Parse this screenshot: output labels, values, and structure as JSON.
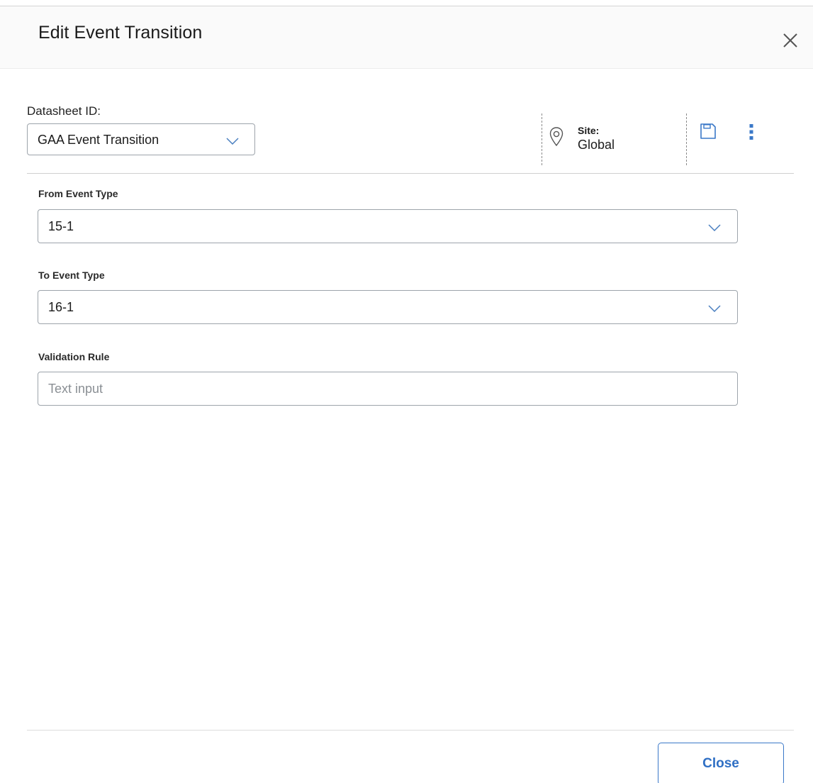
{
  "dialog": {
    "title": "Edit Event Transition"
  },
  "datasheet": {
    "label": "Datasheet ID:",
    "selected": "GAA Event Transition"
  },
  "site": {
    "label": "Site:",
    "value": "Global"
  },
  "icons": {
    "close": "close-icon",
    "site": "location-pin-icon",
    "save": "save-icon",
    "more": "more-vertical-icon",
    "chevron": "chevron-down-icon"
  },
  "fields": {
    "from_event_type": {
      "label": "From Event Type",
      "value": "15-1"
    },
    "to_event_type": {
      "label": "To Event Type",
      "value": "16-1"
    },
    "validation_rule": {
      "label": "Validation Rule",
      "value": "",
      "placeholder": "Text input"
    }
  },
  "footer": {
    "close_label": "Close"
  },
  "colors": {
    "accent": "#2f6fc4",
    "border": "#9da4ab",
    "header_bg": "#fafafa"
  }
}
